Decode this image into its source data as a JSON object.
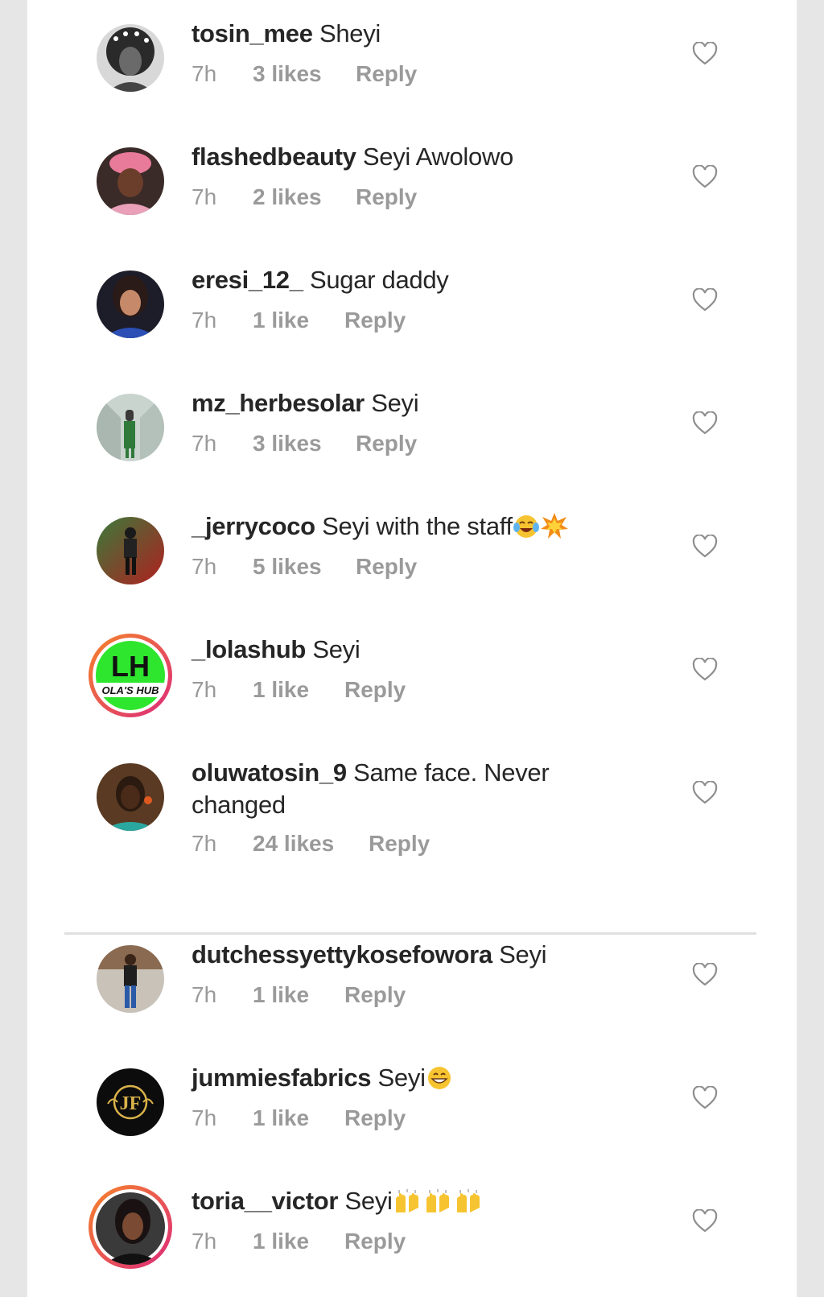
{
  "comments": [
    {
      "user": "tosin_mee",
      "text": " Sheyi",
      "time": "7h",
      "likes": "3 likes",
      "reply": "Reply",
      "avatar_icon": "avatar-photo-woman-headwrap"
    },
    {
      "user": "flashedbeauty",
      "text": " Seyi Awolowo",
      "time": "7h",
      "likes": "2 likes",
      "reply": "Reply",
      "avatar_icon": "avatar-photo-woman-pink-gele"
    },
    {
      "user": "eresi_12_",
      "text": " Sugar daddy",
      "time": "7h",
      "likes": "1 like",
      "reply": "Reply",
      "avatar_icon": "avatar-photo-woman"
    },
    {
      "user": "mz_herbesolar",
      "text": " Seyi",
      "time": "7h",
      "likes": "3 likes",
      "reply": "Reply",
      "avatar_icon": "avatar-photo-hallway"
    },
    {
      "user": "_jerrycoco",
      "text": " Seyi with the staff",
      "time": "7h",
      "likes": "5 likes",
      "reply": "Reply",
      "avatar_icon": "avatar-photo-man"
    },
    {
      "user": "_lolashub",
      "text": " Seyi",
      "time": "7h",
      "likes": "1 like",
      "reply": "Reply",
      "avatar_icon": "avatar-logo-lh",
      "avatar_text": {
        "main": "LH",
        "sub": "OLA'S HUB"
      }
    },
    {
      "user": "oluwatosin_9",
      "text": " Same face. Never changed",
      "time": "7h",
      "likes": "24 likes",
      "reply": "Reply",
      "avatar_icon": "avatar-photo-woman-dark"
    },
    {
      "user": "dutchessyettykosefowora",
      "text": " Seyi",
      "time": "7h",
      "likes": "1 like",
      "reply": "Reply",
      "avatar_icon": "avatar-photo-woman-standing"
    },
    {
      "user": "jummiesfabrics",
      "text": " Seyi",
      "time": "7h",
      "likes": "1 like",
      "reply": "Reply",
      "avatar_icon": "avatar-logo-jf",
      "avatar_text": {
        "main": "JF"
      }
    },
    {
      "user": "toria__victor",
      "text": " Seyi",
      "time": "7h",
      "likes": "1 like",
      "reply": "Reply",
      "avatar_icon": "avatar-photo-woman-story-ring"
    }
  ],
  "colors": {
    "text": "#262626",
    "meta": "#9a9a9a",
    "story_ring_start": "#f58529",
    "story_ring_end": "#dd2a7b",
    "lolashub_green": "#2ee62e"
  },
  "icons": {
    "like": "heart-outline-icon",
    "emoji_laugh": "face-with-tears-of-joy-emoji",
    "emoji_collision": "collision-emoji",
    "emoji_grin": "grinning-face-emoji",
    "emoji_hands": "raising-hands-emoji"
  }
}
